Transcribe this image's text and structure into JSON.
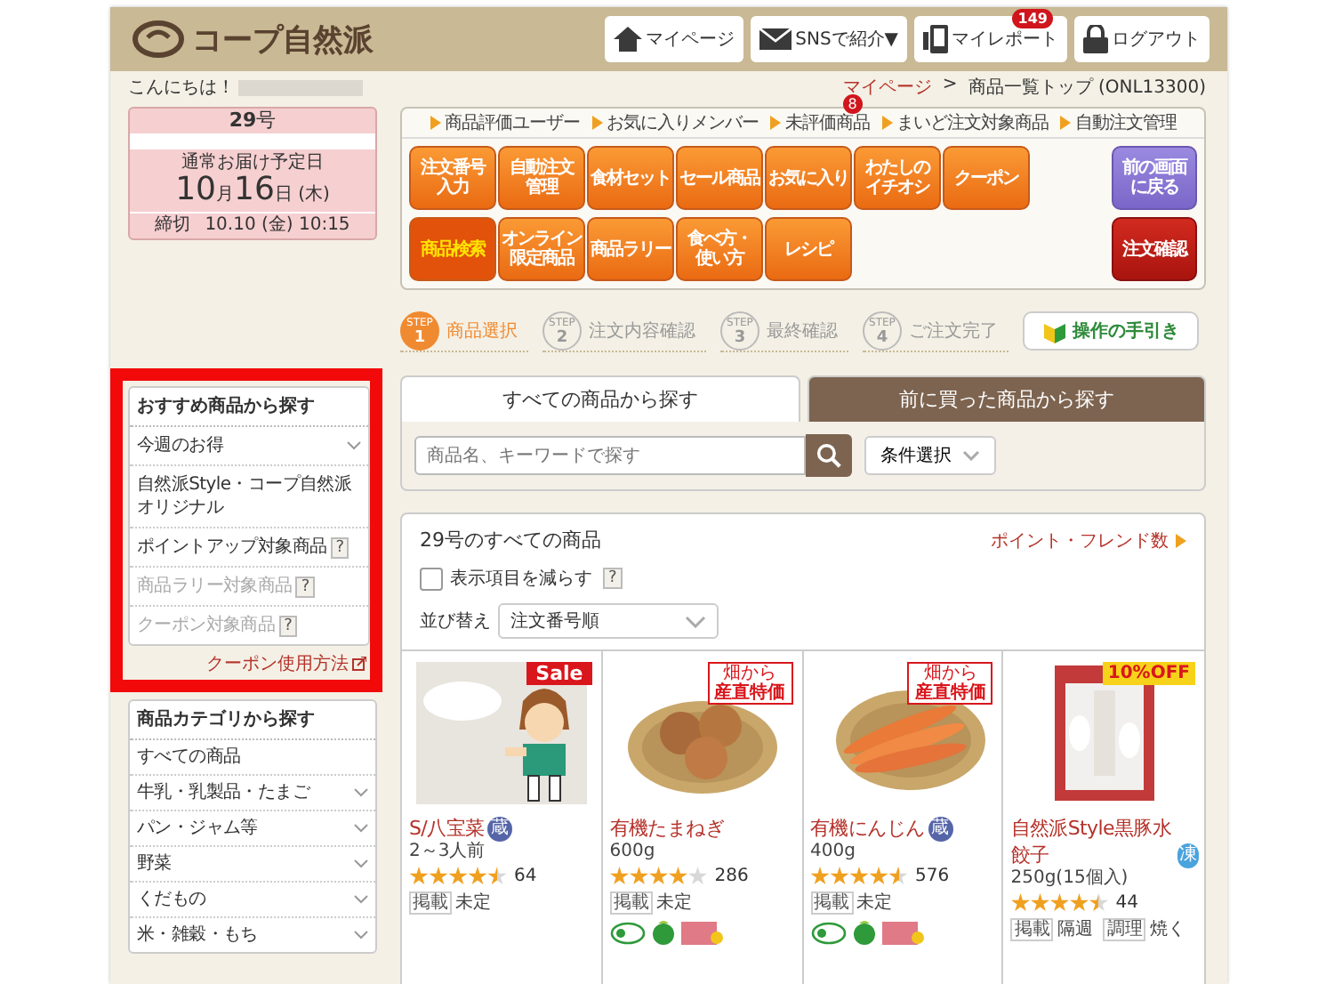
{
  "header": {
    "logo": "コープ自然派",
    "buttons": [
      {
        "kind": "home",
        "label": "マイページ"
      },
      {
        "kind": "mail",
        "label": "SNSで紹介▼"
      },
      {
        "kind": "report",
        "label": "マイレポート",
        "badge": "149"
      },
      {
        "kind": "lock",
        "label": "ログアウト"
      }
    ]
  },
  "greeting": "こんにちは！",
  "breadcrumb": {
    "link": "マイページ",
    "separator": ">",
    "current": "商品一覧トップ (ONL13300)"
  },
  "delivery": {
    "issue": "**29**号",
    "caption": "通常お届け予定日",
    "month": "10",
    "month_unit": "月",
    "day": "16",
    "day_unit": "日",
    "weekday": "(木)",
    "deadline_label": "締切",
    "deadline": "10.10 (金) 10:15"
  },
  "recommend": {
    "highlighted": true,
    "title": "おすすめ商品から探す",
    "items": [
      {
        "label": "今週のお得",
        "expandable": true,
        "disabled": false
      },
      {
        "label": "自然派Style・コープ自然派オリジナル",
        "expandable": false,
        "disabled": false
      },
      {
        "label": "ポイントアップ対象商品",
        "help": "?",
        "expandable": false,
        "disabled": false
      },
      {
        "label": "商品ラリー対象商品",
        "help": "?",
        "expandable": false,
        "disabled": true
      },
      {
        "label": "クーポン対象商品",
        "help": "?",
        "expandable": false,
        "disabled": true
      }
    ],
    "link": "クーポン使用方法"
  },
  "categories": {
    "title": "商品カテゴリから探す",
    "items": [
      {
        "label": "すべての商品",
        "expandable": false
      },
      {
        "label": "牛乳・乳製品・たまご",
        "expandable": true
      },
      {
        "label": "パン・ジャム等",
        "expandable": true
      },
      {
        "label": "野菜",
        "expandable": true
      },
      {
        "label": "くだもの",
        "expandable": true
      },
      {
        "label": "米・雑穀・もち",
        "expandable": true
      }
    ]
  },
  "quick_links": [
    {
      "label": "商品評価ユーザー"
    },
    {
      "label": "お気に入りメンバー"
    },
    {
      "label": "未評価商品",
      "badge": "8"
    },
    {
      "label": "まいど注文対象商品"
    },
    {
      "label": "自動注文管理"
    }
  ],
  "nav_rows": [
    {
      "buttons": [
        {
          "lines": [
            "注文番号",
            "入力"
          ],
          "selected": false
        },
        {
          "lines": [
            "自動注文",
            "管理"
          ],
          "selected": false
        },
        {
          "lines": [
            "食材セット"
          ],
          "selected": false
        },
        {
          "lines": [
            "セール商品"
          ],
          "selected": false
        },
        {
          "lines": [
            "お気に入り"
          ],
          "selected": false
        },
        {
          "lines": [
            "わたしの",
            "イチオシ"
          ],
          "selected": false
        },
        {
          "lines": [
            "クーポン"
          ],
          "selected": false
        }
      ],
      "side": {
        "kind": "back",
        "lines": [
          "前の画面",
          "に戻る"
        ]
      }
    },
    {
      "buttons": [
        {
          "lines": [
            "商品検索"
          ],
          "selected": true
        },
        {
          "lines": [
            "オンライン",
            "限定商品"
          ],
          "selected": false
        },
        {
          "lines": [
            "商品ラリー"
          ],
          "selected": false
        },
        {
          "lines": [
            "食べ方・",
            "使い方"
          ],
          "selected": false
        },
        {
          "lines": [
            "レシピ"
          ],
          "selected": false
        }
      ],
      "side": {
        "kind": "confirm",
        "lines": [
          "注文確認"
        ]
      }
    }
  ],
  "steps": [
    {
      "tag": "STEP",
      "number": "1",
      "label": "商品選択",
      "selected": true
    },
    {
      "tag": "STEP",
      "number": "2",
      "label": "注文内容確認",
      "selected": false
    },
    {
      "tag": "STEP",
      "number": "3",
      "label": "最終確認",
      "selected": false
    },
    {
      "tag": "STEP",
      "number": "4",
      "label": "ご注文完了",
      "selected": false
    }
  ],
  "guide_button": "操作の手引き",
  "tabs": [
    {
      "label": "すべての商品から探す",
      "selected": true
    },
    {
      "label": "前に買った商品から探す",
      "selected": false
    }
  ],
  "search": {
    "placeholder": "商品名、キーワードで探す",
    "filter": "条件選択"
  },
  "products_panel": {
    "title": "29号のすべての商品",
    "link": "ポイント・フレンド数",
    "reduce_label": "表示項目を減らす",
    "reduce_checked": false,
    "help": "?",
    "sort_label": "並び替え",
    "sort_value": "注文番号順"
  },
  "products": [
    {
      "name": "S/八宝菜",
      "temp": {
        "kind": "chilled",
        "text": "蔵"
      },
      "size": "2～3人前",
      "stars": 4.5,
      "count": "64",
      "tags": [
        {
          "label": "掲載",
          "value": "未定"
        }
      ],
      "badge": {
        "kind": "sale",
        "text": "Sale"
      }
    },
    {
      "name": "有機たまねぎ",
      "size": "600g",
      "stars": 4,
      "count": "286",
      "tags": [
        {
          "label": "掲載",
          "value": "未定"
        }
      ],
      "badge": {
        "kind": "direct",
        "small": "畑から",
        "text": "産直特価"
      },
      "marks": [
        {
          "kind": "organic"
        },
        {
          "kind": "eco"
        },
        {
          "kind": "neonic"
        }
      ]
    },
    {
      "name": "有機にんじん",
      "temp": {
        "kind": "chilled",
        "text": "蔵"
      },
      "size": "400g",
      "stars": 4.5,
      "count": "576",
      "tags": [
        {
          "label": "掲載",
          "value": "未定"
        }
      ],
      "badge": {
        "kind": "direct",
        "small": "畑から",
        "text": "産直特価"
      },
      "marks": [
        {
          "kind": "organic"
        },
        {
          "kind": "eco"
        },
        {
          "kind": "neonic"
        }
      ]
    },
    {
      "name": "自然派Style黒豚水餃子",
      "temp": {
        "kind": "frozen",
        "text": "凍"
      },
      "size": "250g(15個入)",
      "stars": 4.5,
      "count": "44",
      "tags": [
        {
          "label": "掲載",
          "value": "隔週"
        },
        {
          "label": "調理",
          "value": "焼く"
        }
      ],
      "badge": {
        "kind": "discount",
        "text": "10%OFF"
      }
    }
  ]
}
